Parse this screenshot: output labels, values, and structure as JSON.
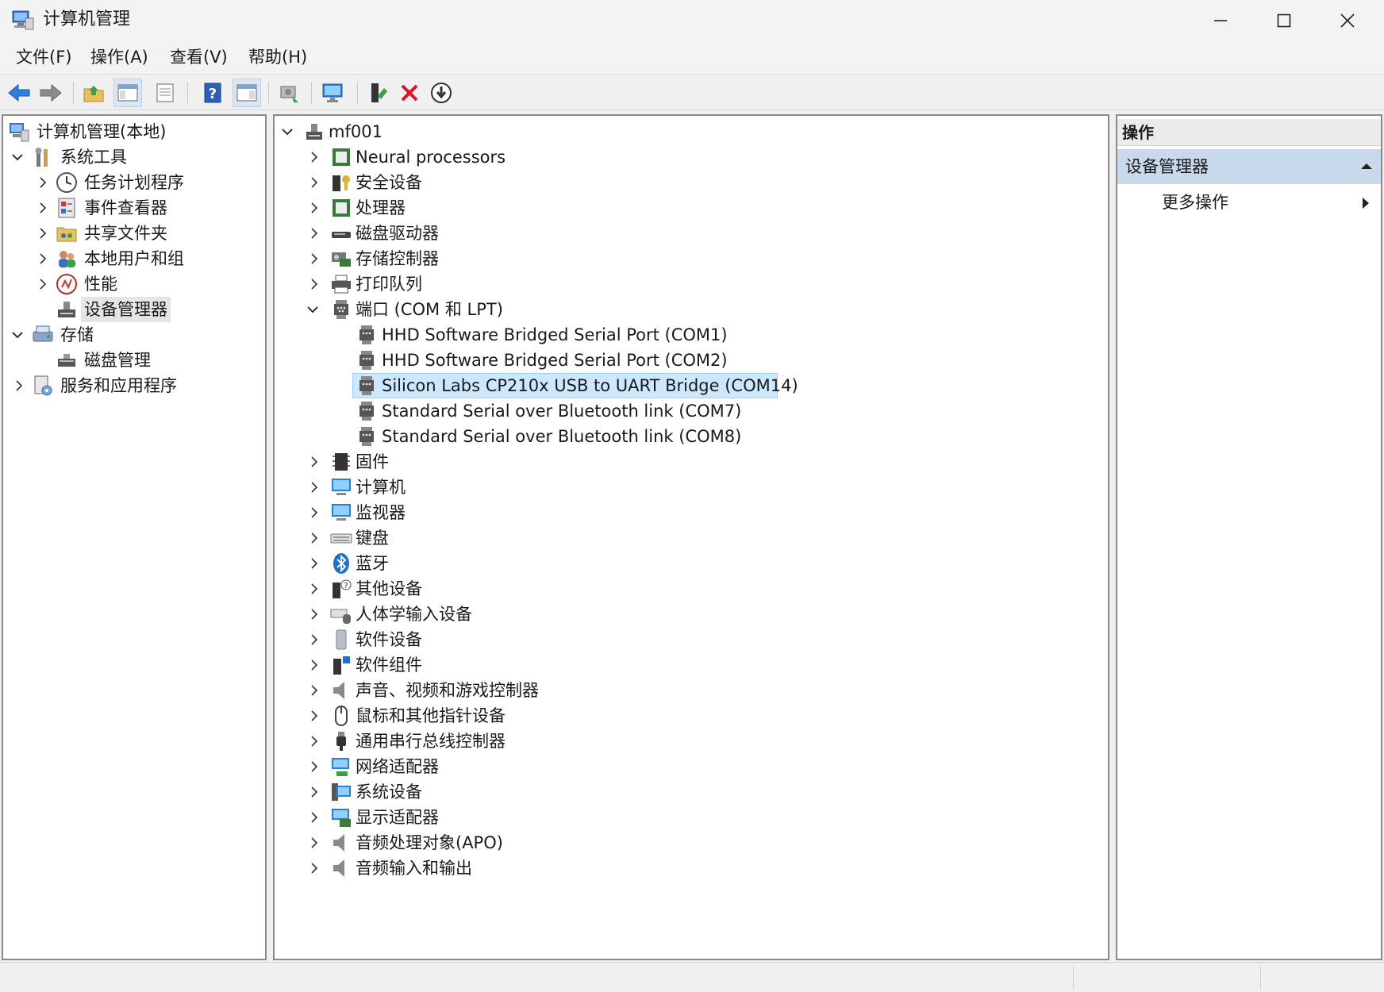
{
  "window": {
    "title": "计算机管理",
    "controls": [
      "minimize",
      "maximize",
      "close"
    ]
  },
  "menu": [
    {
      "label": "文件(F)"
    },
    {
      "label": "操作(A)"
    },
    {
      "label": "查看(V)"
    },
    {
      "label": "帮助(H)"
    }
  ],
  "toolbar": {
    "buttons": [
      "back-icon",
      "forward-icon",
      "up-folder-icon",
      "show-tree-icon",
      "properties-icon",
      "help-icon",
      "show-action-pane-icon",
      "scan-hardware-icon",
      "monitor-icon",
      "update-driver-icon",
      "uninstall-icon",
      "disable-icon"
    ]
  },
  "left_tree": {
    "root": "计算机管理(本地)",
    "system_tools": "系统工具",
    "task_scheduler": "任务计划程序",
    "event_viewer": "事件查看器",
    "shared_folders": "共享文件夹",
    "local_users": "本地用户和组",
    "performance": "性能",
    "device_manager": "设备管理器",
    "storage": "存储",
    "disk_management": "磁盘管理",
    "services": "服务和应用程序"
  },
  "device_tree": {
    "computer": "mf001",
    "neural": "Neural processors",
    "security": "安全设备",
    "processors": "处理器",
    "disk_drives": "磁盘驱动器",
    "storage_ctrl": "存储控制器",
    "print_queue": "打印队列",
    "ports": "端口 (COM 和 LPT)",
    "port_com1": "HHD Software Bridged Serial Port (COM1)",
    "port_com2": "HHD Software Bridged Serial Port (COM2)",
    "port_com14": "Silicon Labs CP210x USB to UART Bridge (COM14)",
    "port_com7": "Standard Serial over Bluetooth link (COM7)",
    "port_com8": "Standard Serial over Bluetooth link (COM8)",
    "firmware": "固件",
    "computer_cat": "计算机",
    "monitors": "监视器",
    "keyboards": "键盘",
    "bluetooth": "蓝牙",
    "other": "其他设备",
    "hid": "人体学输入设备",
    "software_dev": "软件设备",
    "software_comp": "软件组件",
    "sound": "声音、视频和游戏控制器",
    "mice": "鼠标和其他指针设备",
    "usb": "通用串行总线控制器",
    "network": "网络适配器",
    "system_dev": "系统设备",
    "display": "显示适配器",
    "apo": "音频处理对象(APO)",
    "audio_io": "音频输入和输出"
  },
  "actions": {
    "header": "操作",
    "section": "设备管理器",
    "more": "更多操作"
  },
  "colors": {
    "selection_blue": "#cce8ff",
    "selection_border": "#99d1ff",
    "action_section": "#c9d9ec",
    "delete_red": "#e81123"
  }
}
